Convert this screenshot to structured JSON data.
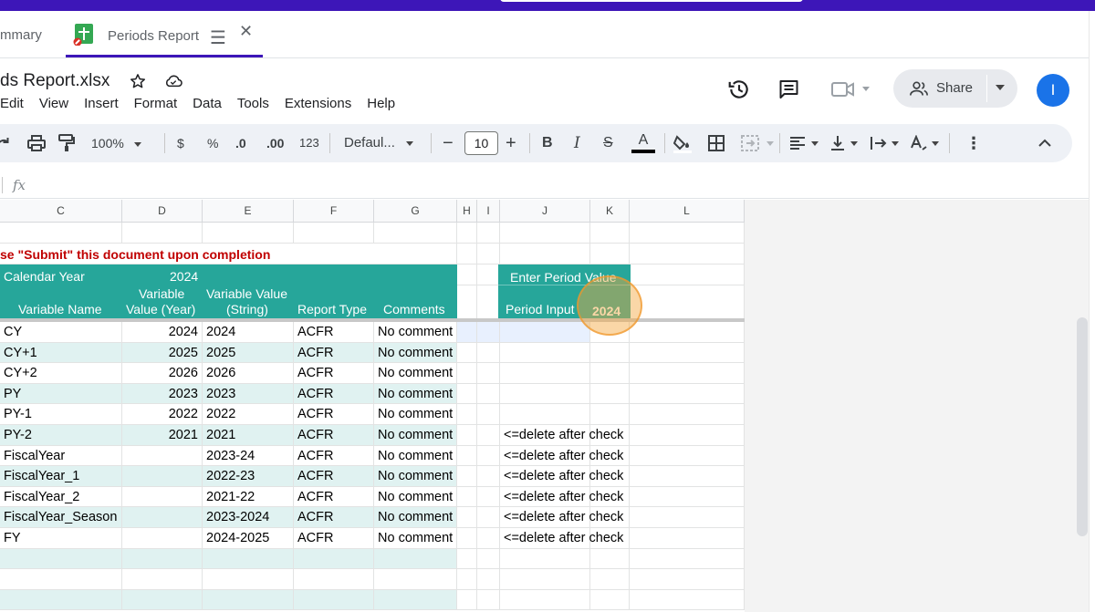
{
  "tabs": {
    "inactive_label": "mmary",
    "active_label": "Periods Report"
  },
  "doc": {
    "title": "ds Report.xlsx",
    "menu": [
      "Edit",
      "View",
      "Insert",
      "Format",
      "Data",
      "Tools",
      "Extensions",
      "Help"
    ],
    "share_label": "Share",
    "avatar_initial": "I"
  },
  "toolbar": {
    "zoom": "100%",
    "currency": "$",
    "percent": "%",
    "dec_decrease": ".0",
    "dec_increase": ".00",
    "number_format": "123",
    "font": "Defaul...",
    "font_size": "10",
    "bold": "B",
    "italic": "I",
    "text_color": "A"
  },
  "formula_bar": {
    "fx": "fx"
  },
  "columns": [
    "C",
    "D",
    "E",
    "F",
    "G",
    "H",
    "I",
    "J",
    "K",
    "L"
  ],
  "sheet": {
    "notice": "se \"Submit\" this document upon completion",
    "calendar_year_label": "Calendar Year",
    "calendar_year_value": "2024",
    "headers": {
      "c": "Variable Name",
      "d_line1": "Variable",
      "d_line2": "Value (Year)",
      "e_line1": "Variable Value",
      "e_line2": "(String)",
      "f": "Report Type",
      "g": "Comments"
    },
    "period_box": {
      "title": "Enter Period Value",
      "input_label": "Period Input",
      "input_value": "2024"
    },
    "rows": [
      {
        "c": "CY",
        "d": "2024",
        "e": "2024",
        "f": "ACFR",
        "g": "No comment",
        "j": ""
      },
      {
        "c": "CY+1",
        "d": "2025",
        "e": "2025",
        "f": "ACFR",
        "g": "No comment",
        "j": ""
      },
      {
        "c": "CY+2",
        "d": "2026",
        "e": "2026",
        "f": "ACFR",
        "g": "No comment",
        "j": ""
      },
      {
        "c": "PY",
        "d": "2023",
        "e": "2023",
        "f": "ACFR",
        "g": "No comment",
        "j": ""
      },
      {
        "c": "PY-1",
        "d": "2022",
        "e": "2022",
        "f": "ACFR",
        "g": "No comment",
        "j": ""
      },
      {
        "c": "PY-2",
        "d": "2021",
        "e": "2021",
        "f": "ACFR",
        "g": "No comment",
        "j": "<=delete after check"
      },
      {
        "c": "FiscalYear",
        "d": "",
        "e": "2023-24",
        "f": "ACFR",
        "g": "No comment",
        "j": "<=delete after check"
      },
      {
        "c": "FiscalYear_1",
        "d": "",
        "e": "2022-23",
        "f": "ACFR",
        "g": "No comment",
        "j": "<=delete after check"
      },
      {
        "c": "FiscalYear_2",
        "d": "",
        "e": "2021-22",
        "f": "ACFR",
        "g": "No comment",
        "j": "<=delete after check"
      },
      {
        "c": "FiscalYear_Season",
        "d": "",
        "e": "2023-2024",
        "f": "ACFR",
        "g": "No comment",
        "j": "<=delete after check"
      },
      {
        "c": "FY",
        "d": "",
        "e": "2024-2025",
        "f": "ACFR",
        "g": "No comment",
        "j": "<=delete after check"
      }
    ]
  },
  "colors": {
    "top_strip": "#3d16b8",
    "header_teal": "#26a69a",
    "band_teal": "#e0f2f1",
    "notice_red": "#c00000",
    "avatar_blue": "#1a73e8"
  }
}
